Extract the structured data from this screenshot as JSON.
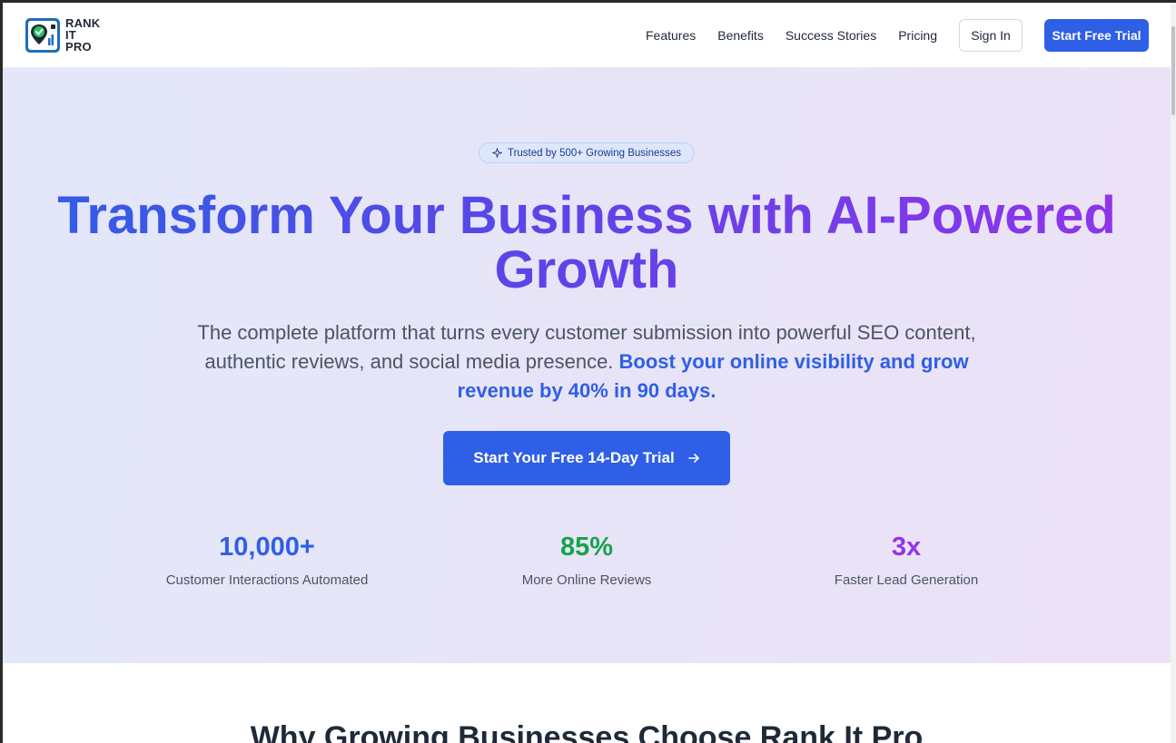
{
  "brand": {
    "line1": "RANK",
    "line2": "IT",
    "line3": "PRO",
    "colors": {
      "primary": "#2f5fe6",
      "logo_bg": "#1d6fb8",
      "check": "#22c55e"
    }
  },
  "nav": {
    "links": [
      "Features",
      "Benefits",
      "Success Stories",
      "Pricing"
    ],
    "signin_label": "Sign In",
    "trial_label": "Start Free Trial"
  },
  "hero": {
    "badge": "Trusted by 500+ Growing Businesses",
    "badge_icon": "sparkle-icon",
    "headline_line1": "Transform Your Business with AI-Powered",
    "headline_line2": "Growth",
    "sub_text": "The complete platform that turns every customer submission into powerful SEO content, authentic reviews, and social media presence.",
    "sub_highlight": "Boost your online visibility and grow revenue by 40% in 90 days.",
    "cta_label": "Start Your Free 14-Day Trial",
    "cta_icon": "arrow-right-icon",
    "stats": [
      {
        "value": "10,000+",
        "label": "Customer Interactions Automated",
        "color": "#2f5fe6"
      },
      {
        "value": "85%",
        "label": "More Online Reviews",
        "color": "#16a34a"
      },
      {
        "value": "3x",
        "label": "Faster Lead Generation",
        "color": "#9333ea"
      }
    ]
  },
  "next_section": {
    "title": "Why Growing Businesses Choose Rank It Pro"
  }
}
